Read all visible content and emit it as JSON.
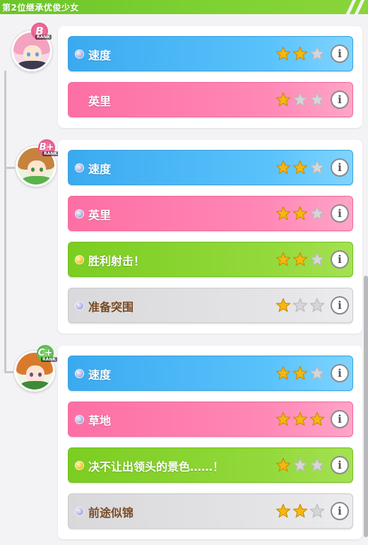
{
  "header": {
    "title": "第2位继承优俊少女"
  },
  "colors": {
    "blue_factor": "#3aaaf0",
    "pink_factor": "#fd6fa4",
    "green_factor": "#7ccd22",
    "gray_factor": "#d9d9dc",
    "star_filled": "#f5b810",
    "star_empty": "#d6d6d8"
  },
  "icons": {
    "info": "i",
    "factor_dot": "orb-icon",
    "star": "star-icon"
  },
  "parents": [
    {
      "rank": "B",
      "rank_text": "RANK",
      "factors": [
        {
          "label": "速度",
          "color": "blue",
          "stars": 2,
          "max_stars": 3,
          "dot": "silver"
        },
        {
          "label": "英里",
          "color": "pink",
          "stars": 1,
          "max_stars": 3,
          "dot": "none"
        }
      ]
    },
    {
      "rank": "B+",
      "rank_text": "RANK",
      "factors": [
        {
          "label": "速度",
          "color": "blue",
          "stars": 2,
          "max_stars": 3,
          "dot": "silver"
        },
        {
          "label": "英里",
          "color": "pink",
          "stars": 2,
          "max_stars": 3,
          "dot": "silver"
        },
        {
          "label": "胜利射击！",
          "color": "green",
          "stars": 2,
          "max_stars": 3,
          "dot": "gold"
        },
        {
          "label": "准备突围",
          "color": "gray",
          "stars": 1,
          "max_stars": 3,
          "dot": "silver"
        }
      ]
    },
    {
      "rank": "C+",
      "rank_text": "RANK",
      "factors": [
        {
          "label": "速度",
          "color": "blue",
          "stars": 2,
          "max_stars": 3,
          "dot": "silver"
        },
        {
          "label": "草地",
          "color": "pink",
          "stars": 3,
          "max_stars": 3,
          "dot": "silver"
        },
        {
          "label": "决不让出领头的景色……！",
          "color": "green",
          "stars": 1,
          "max_stars": 3,
          "dot": "gold"
        },
        {
          "label": "前途似锦",
          "color": "gray",
          "stars": 2,
          "max_stars": 3,
          "dot": "silver"
        }
      ]
    }
  ]
}
